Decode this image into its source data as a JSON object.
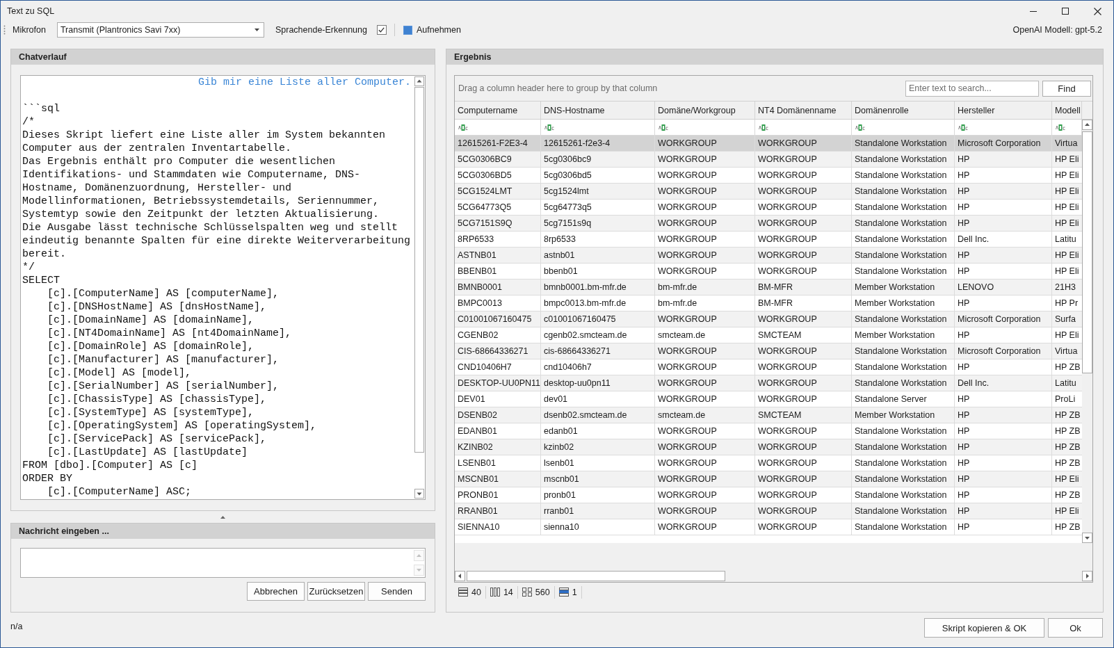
{
  "window": {
    "title": "Text zu SQL"
  },
  "toolbar": {
    "microphone_label": "Mikrofon",
    "microphone": {
      "value": "Transmit (Plantronics Savi 7xx)"
    },
    "speech_end_detection": {
      "label": "Sprachende-Erkennung",
      "checked": true
    },
    "record": {
      "label": "Aufnehmen"
    },
    "model_info": "OpenAI Modell: gpt-5.2"
  },
  "chat_panel": {
    "title": "Chatverlauf",
    "messages": [
      {
        "kind": "user",
        "lines": [
          "Gib mir eine Liste aller Computer."
        ]
      },
      {
        "kind": "assistant",
        "lines": [
          "```sql",
          "/*",
          "Dieses Skript liefert eine Liste aller im System bekannten",
          "Computer aus der zentralen Inventartabelle.",
          "Das Ergebnis enthält pro Computer die wesentlichen",
          "Identifikations- und Stammdaten wie Computername, DNS-",
          "Hostname, Domänenzuordnung, Hersteller- und",
          "Modellinformationen, Betriebssystemdetails, Seriennummer,",
          "Systemtyp sowie den Zeitpunkt der letzten Aktualisierung.",
          "Die Ausgabe lässt technische Schlüsselspalten weg und stellt",
          "eindeutig benannte Spalten für eine direkte Weiterverarbeitung",
          "bereit.",
          "*/",
          "SELECT",
          "    [c].[ComputerName] AS [computerName],",
          "    [c].[DNSHostName] AS [dnsHostName],",
          "    [c].[DomainName] AS [domainName],",
          "    [c].[NT4DomainName] AS [nt4DomainName],",
          "    [c].[DomainRole] AS [domainRole],",
          "    [c].[Manufacturer] AS [manufacturer],",
          "    [c].[Model] AS [model],",
          "    [c].[SerialNumber] AS [serialNumber],",
          "    [c].[ChassisType] AS [chassisType],",
          "    [c].[SystemType] AS [systemType],",
          "    [c].[OperatingSystem] AS [operatingSystem],",
          "    [c].[ServicePack] AS [servicePack],",
          "    [c].[LastUpdate] AS [lastUpdate]",
          "FROM [dbo].[Computer] AS [c]",
          "ORDER BY",
          "    [c].[ComputerName] ASC;"
        ]
      }
    ]
  },
  "message_panel": {
    "title": "Nachricht eingeben ...",
    "buttons": [
      "Abbrechen",
      "Zurücksetzen",
      "Senden"
    ]
  },
  "result_panel": {
    "title": "Ergebnis",
    "group_hint": "Drag a column header here to group by that column",
    "search": {
      "placeholder": "Enter text to search..."
    },
    "find_button": "Find",
    "columns": [
      "Computername",
      "DNS-Hostname",
      "Domäne/Workgroup",
      "NT4 Domänenname",
      "Domänenrolle",
      "Hersteller",
      "Modell"
    ],
    "rows": [
      {
        "selected": true,
        "cells": [
          "12615261-F2E3-4",
          "12615261-f2e3-4",
          "WORKGROUP",
          "WORKGROUP",
          "Standalone Workstation",
          "Microsoft Corporation",
          "Virtua"
        ]
      },
      {
        "selected": false,
        "cells": [
          "5CG0306BC9",
          "5cg0306bc9",
          "WORKGROUP",
          "WORKGROUP",
          "Standalone Workstation",
          "HP",
          "HP Eli"
        ]
      },
      {
        "selected": false,
        "cells": [
          "5CG0306BD5",
          "5cg0306bd5",
          "WORKGROUP",
          "WORKGROUP",
          "Standalone Workstation",
          "HP",
          "HP Eli"
        ]
      },
      {
        "selected": false,
        "cells": [
          "5CG1524LMT",
          "5cg1524lmt",
          "WORKGROUP",
          "WORKGROUP",
          "Standalone Workstation",
          "HP",
          "HP Eli"
        ]
      },
      {
        "selected": false,
        "cells": [
          "5CG64773Q5",
          "5cg64773q5",
          "WORKGROUP",
          "WORKGROUP",
          "Standalone Workstation",
          "HP",
          "HP Eli"
        ]
      },
      {
        "selected": false,
        "cells": [
          "5CG7151S9Q",
          "5cg7151s9q",
          "WORKGROUP",
          "WORKGROUP",
          "Standalone Workstation",
          "HP",
          "HP Eli"
        ]
      },
      {
        "selected": false,
        "cells": [
          "8RP6533",
          "8rp6533",
          "WORKGROUP",
          "WORKGROUP",
          "Standalone Workstation",
          "Dell Inc.",
          "Latitu"
        ]
      },
      {
        "selected": false,
        "cells": [
          "ASTNB01",
          "astnb01",
          "WORKGROUP",
          "WORKGROUP",
          "Standalone Workstation",
          "HP",
          "HP Eli"
        ]
      },
      {
        "selected": false,
        "cells": [
          "BBENB01",
          "bbenb01",
          "WORKGROUP",
          "WORKGROUP",
          "Standalone Workstation",
          "HP",
          "HP Eli"
        ]
      },
      {
        "selected": false,
        "cells": [
          "BMNB0001",
          "bmnb0001.bm-mfr.de",
          "bm-mfr.de",
          "BM-MFR",
          "Member Workstation",
          "LENOVO",
          "21H3"
        ]
      },
      {
        "selected": false,
        "cells": [
          "BMPC0013",
          "bmpc0013.bm-mfr.de",
          "bm-mfr.de",
          "BM-MFR",
          "Member Workstation",
          "HP",
          "HP Pr"
        ]
      },
      {
        "selected": false,
        "cells": [
          "C01001067160475",
          "c01001067160475",
          "WORKGROUP",
          "WORKGROUP",
          "Standalone Workstation",
          "Microsoft Corporation",
          "Surfa"
        ]
      },
      {
        "selected": false,
        "cells": [
          "CGENB02",
          "cgenb02.smcteam.de",
          "smcteam.de",
          "SMCTEAM",
          "Member Workstation",
          "HP",
          "HP Eli"
        ]
      },
      {
        "selected": false,
        "cells": [
          "CIS-68664336271",
          "cis-68664336271",
          "WORKGROUP",
          "WORKGROUP",
          "Standalone Workstation",
          "Microsoft Corporation",
          "Virtua"
        ]
      },
      {
        "selected": false,
        "cells": [
          "CND10406H7",
          "cnd10406h7",
          "WORKGROUP",
          "WORKGROUP",
          "Standalone Workstation",
          "HP",
          "HP ZB"
        ]
      },
      {
        "selected": false,
        "cells": [
          "DESKTOP-UU0PN11",
          "desktop-uu0pn11",
          "WORKGROUP",
          "WORKGROUP",
          "Standalone Workstation",
          "Dell Inc.",
          "Latitu"
        ]
      },
      {
        "selected": false,
        "cells": [
          "DEV01",
          "dev01",
          "WORKGROUP",
          "WORKGROUP",
          "Standalone Server",
          "HP",
          "ProLi"
        ]
      },
      {
        "selected": false,
        "cells": [
          "DSENB02",
          "dsenb02.smcteam.de",
          "smcteam.de",
          "SMCTEAM",
          "Member Workstation",
          "HP",
          "HP ZB"
        ]
      },
      {
        "selected": false,
        "cells": [
          "EDANB01",
          "edanb01",
          "WORKGROUP",
          "WORKGROUP",
          "Standalone Workstation",
          "HP",
          "HP ZB"
        ]
      },
      {
        "selected": false,
        "cells": [
          "KZINB02",
          "kzinb02",
          "WORKGROUP",
          "WORKGROUP",
          "Standalone Workstation",
          "HP",
          "HP ZB"
        ]
      },
      {
        "selected": false,
        "cells": [
          "LSENB01",
          "lsenb01",
          "WORKGROUP",
          "WORKGROUP",
          "Standalone Workstation",
          "HP",
          "HP ZB"
        ]
      },
      {
        "selected": false,
        "cells": [
          "MSCNB01",
          "mscnb01",
          "WORKGROUP",
          "WORKGROUP",
          "Standalone Workstation",
          "HP",
          "HP Eli"
        ]
      },
      {
        "selected": false,
        "cells": [
          "PRONB01",
          "pronb01",
          "WORKGROUP",
          "WORKGROUP",
          "Standalone Workstation",
          "HP",
          "HP ZB"
        ]
      },
      {
        "selected": false,
        "cells": [
          "RRANB01",
          "rranb01",
          "WORKGROUP",
          "WORKGROUP",
          "Standalone Workstation",
          "HP",
          "HP Eli"
        ]
      },
      {
        "selected": false,
        "cells": [
          "SIENNA10",
          "sienna10",
          "WORKGROUP",
          "WORKGROUP",
          "Standalone Workstation",
          "HP",
          "HP ZB"
        ]
      }
    ],
    "summary": [
      {
        "kind": "rows",
        "value": "40"
      },
      {
        "kind": "columns",
        "value": "14"
      },
      {
        "kind": "cells",
        "value": "560"
      },
      {
        "kind": "selected",
        "value": "1"
      }
    ]
  },
  "status_bar": {
    "text": "n/a"
  },
  "buttons": [
    "Skript kopieren & OK",
    "Ok"
  ]
}
